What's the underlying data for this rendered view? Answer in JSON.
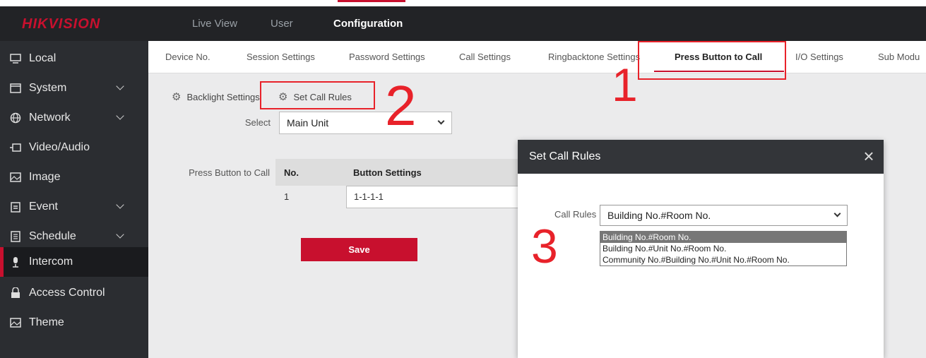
{
  "header": {
    "logo": "HIKVISION",
    "nav": [
      "Live View",
      "User",
      "Configuration"
    ]
  },
  "sidebar": {
    "items": [
      {
        "label": "Local",
        "icon": "monitor-icon"
      },
      {
        "label": "System",
        "icon": "window-icon"
      },
      {
        "label": "Network",
        "icon": "globe-icon"
      },
      {
        "label": "Video/Audio",
        "icon": "camera-icon"
      },
      {
        "label": "Image",
        "icon": "image-icon"
      },
      {
        "label": "Event",
        "icon": "calendar-icon"
      },
      {
        "label": "Schedule",
        "icon": "list-icon"
      },
      {
        "label": "Intercom",
        "icon": "microphone-icon"
      },
      {
        "label": "Access Control",
        "icon": "lock-icon"
      },
      {
        "label": "Theme",
        "icon": "image-icon"
      }
    ]
  },
  "tabs": [
    "Device No.",
    "Session Settings",
    "Password Settings",
    "Call Settings",
    "Ringbacktone Settings",
    "Press Button to Call",
    "I/O Settings",
    "Sub Modu"
  ],
  "subtabs": {
    "backlight": "Backlight Settings",
    "call_rules": "Set Call Rules"
  },
  "form": {
    "select_label": "Select",
    "select_value": "Main Unit",
    "press_label": "Press Button to Call",
    "table_headers": [
      "No.",
      "Button Settings"
    ],
    "row_no": "1",
    "row_value": "1-1-1-1",
    "save": "Save"
  },
  "annotations": [
    "1",
    "2",
    "3"
  ],
  "annotation_color": "#e8222a",
  "accent_color": "#c8102e",
  "modal": {
    "title": "Set Call Rules",
    "close": "×",
    "label": "Call Rules",
    "value": "Building No.#Room No.",
    "options": [
      "Building No.#Room No.",
      "Building No.#Unit No.#Room No.",
      "Community No.#Building No.#Unit No.#Room No."
    ]
  }
}
